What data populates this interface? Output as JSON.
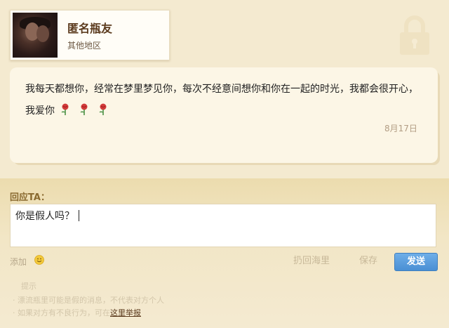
{
  "profile": {
    "name": "匿名瓶友",
    "region": "其他地区"
  },
  "icons": {
    "lock": "lock-icon",
    "emoji": "smiley-icon",
    "rose": "rose-icon"
  },
  "message": {
    "text": "我每天都想你，经常在梦里梦见你，每次不经意间想你和你在一起的时光，我都会很开心，我爱你",
    "rose_count": 3,
    "date": "8月17日"
  },
  "reply": {
    "label": "回应TA：",
    "input_value": "你是假人吗？"
  },
  "toolbar": {
    "add_label": "添加",
    "throw_back_label": "扔回海里",
    "save_label": "保存",
    "send_label": "发送"
  },
  "tips": {
    "title": "提示",
    "line1": "· 漂流瓶里可能是假的消息，不代表对方个人",
    "line2_prefix": "· 如果对方有不良行为，可在",
    "report_link": "这里举报"
  },
  "colors": {
    "accent": "#4a8fd4",
    "background": "#f4ead0",
    "name_color": "#5b3a1d"
  }
}
